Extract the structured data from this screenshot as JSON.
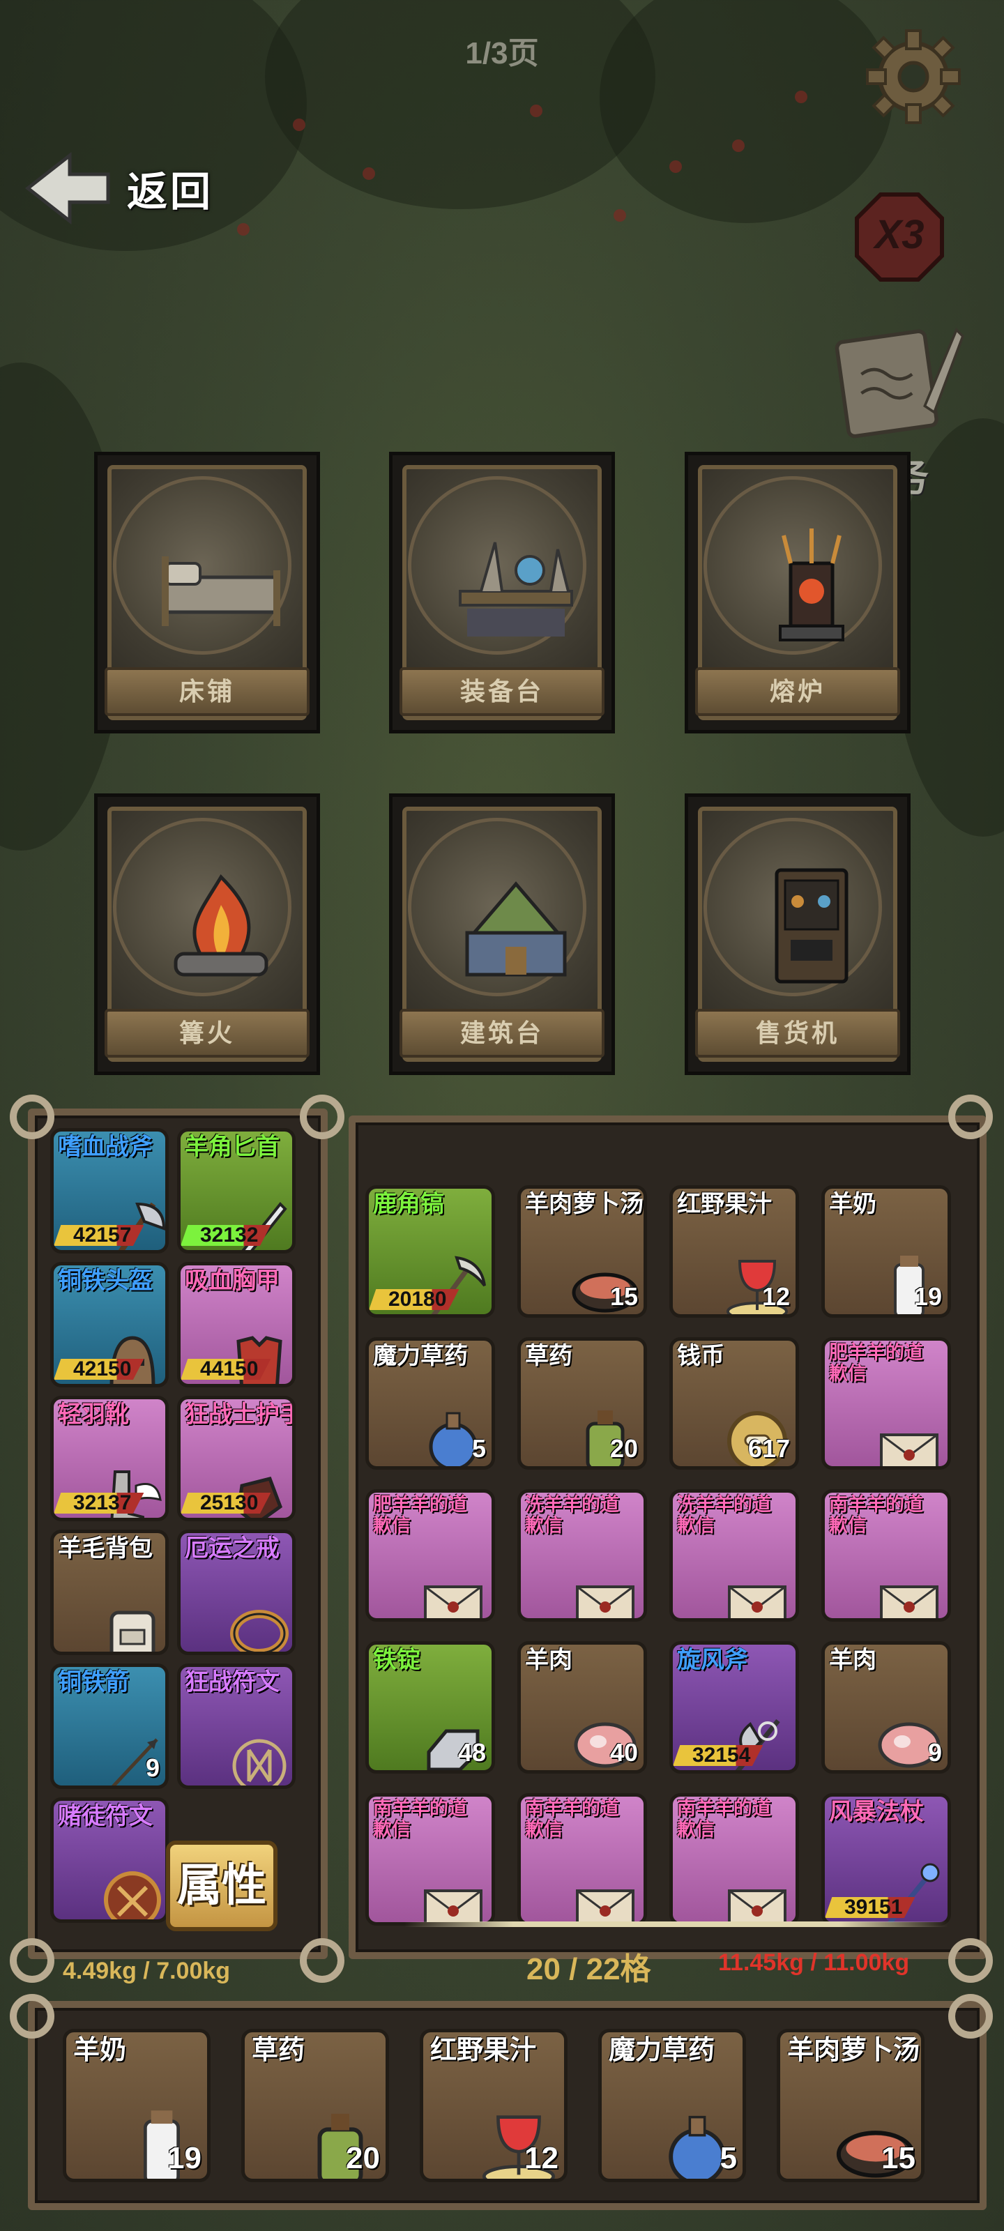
{
  "page_indicator": "1/3页",
  "back_label": "返回",
  "multiplier": "X3",
  "task_label": "任务",
  "stations": [
    {
      "label": "床铺",
      "icon": "bed-icon"
    },
    {
      "label": "装备台",
      "icon": "equipment-table-icon"
    },
    {
      "label": "熔炉",
      "icon": "furnace-icon"
    },
    {
      "label": "篝火",
      "icon": "campfire-icon"
    },
    {
      "label": "建筑台",
      "icon": "building-table-icon"
    },
    {
      "label": "售货机",
      "icon": "vending-machine-icon"
    }
  ],
  "equipment": [
    {
      "name": "嗜血战斧",
      "durability": "42157",
      "name_color": "blue",
      "bg": "blue",
      "icon": "axe-icon",
      "bar": "#e9c43c"
    },
    {
      "name": "羊角匕首",
      "durability": "32132",
      "name_color": "green",
      "bg": "green",
      "icon": "dagger-icon",
      "bar": "#7cf23d"
    },
    {
      "name": "铜铁头盔",
      "durability": "42150",
      "name_color": "blue",
      "bg": "blue",
      "icon": "helmet-icon",
      "bar": "#e9c43c"
    },
    {
      "name": "吸血胸甲",
      "durability": "44150",
      "name_color": "pink",
      "bg": "pink",
      "icon": "chestplate-icon",
      "bar": "#e9c43c"
    },
    {
      "name": "轻羽靴",
      "durability": "32137",
      "name_color": "pink",
      "bg": "pink",
      "icon": "boots-icon",
      "bar": "#e9c43c"
    },
    {
      "name": "狂战士护手",
      "durability": "25130",
      "name_color": "pink",
      "bg": "pink",
      "icon": "gauntlet-icon",
      "bar": "#e9c43c"
    },
    {
      "name": "羊毛背包",
      "count": "",
      "name_color": "white",
      "bg": "brown",
      "icon": "backpack-icon"
    },
    {
      "name": "厄运之戒",
      "count": "",
      "name_color": "purple",
      "bg": "purple",
      "icon": "ring-icon"
    },
    {
      "name": "铜铁箭",
      "count": "9",
      "name_color": "blue",
      "bg": "blue",
      "icon": "arrow-icon"
    },
    {
      "name": "狂战符文",
      "count": "",
      "name_color": "purple",
      "bg": "purple",
      "icon": "rune-icon"
    },
    {
      "name": "赌徒符文",
      "count": "",
      "name_color": "purple",
      "bg": "purple",
      "icon": "knot-rune-icon"
    }
  ],
  "attr_button": "属性",
  "equip_weight": "4.49kg / 7.00kg",
  "inventory": [
    {
      "name": "鹿角镐",
      "durability": "20180",
      "name_color": "green",
      "bg": "green",
      "icon": "pickaxe-icon",
      "bar": "#e9c43c"
    },
    {
      "name": "羊肉萝卜汤",
      "count": "15",
      "bg": "brown",
      "icon": "stew-icon"
    },
    {
      "name": "红野果汁",
      "count": "12",
      "bg": "brown",
      "icon": "juice-icon"
    },
    {
      "name": "羊奶",
      "count": "19",
      "bg": "brown",
      "icon": "milk-icon"
    },
    {
      "name": "魔力草药",
      "count": "5",
      "bg": "brown",
      "icon": "mana-potion-icon"
    },
    {
      "name": "草药",
      "count": "20",
      "bg": "brown",
      "icon": "herb-potion-icon"
    },
    {
      "name": "钱币",
      "count": "617",
      "bg": "brown",
      "icon": "coin-icon"
    },
    {
      "name": "肥羊羊的道歉信",
      "count": "",
      "name_color": "pink",
      "bg": "pink",
      "icon": "letter-icon"
    },
    {
      "name": "肥羊羊的道歉信",
      "count": "",
      "name_color": "pink",
      "bg": "pink",
      "icon": "letter-icon"
    },
    {
      "name": "洗羊羊的道歉信",
      "count": "",
      "name_color": "pink",
      "bg": "pink",
      "icon": "letter-icon"
    },
    {
      "name": "洗羊羊的道歉信",
      "count": "",
      "name_color": "pink",
      "bg": "pink",
      "icon": "letter-icon"
    },
    {
      "name": "南羊羊的道歉信",
      "count": "",
      "name_color": "pink",
      "bg": "pink",
      "icon": "letter-icon"
    },
    {
      "name": "铁锭",
      "count": "48",
      "name_color": "green",
      "bg": "green",
      "icon": "iron-ingot-icon"
    },
    {
      "name": "羊肉",
      "count": "40",
      "bg": "brown",
      "icon": "meat-icon"
    },
    {
      "name": "旋风斧",
      "durability": "32154",
      "name_color": "blue",
      "bg": "purple",
      "icon": "whirlwind-axe-icon",
      "bar": "#e9c43c"
    },
    {
      "name": "羊肉",
      "count": "9",
      "bg": "brown",
      "icon": "meat-icon"
    },
    {
      "name": "南羊羊的道歉信",
      "count": "",
      "name_color": "pink",
      "bg": "pink",
      "icon": "letter-icon"
    },
    {
      "name": "南羊羊的道歉信",
      "count": "",
      "name_color": "pink",
      "bg": "pink",
      "icon": "letter-icon"
    },
    {
      "name": "南羊羊的道歉信",
      "count": "",
      "name_color": "pink",
      "bg": "pink",
      "icon": "letter-icon"
    },
    {
      "name": "风暴法杖",
      "durability": "39151",
      "name_color": "pink",
      "bg": "purple",
      "icon": "storm-staff-icon",
      "bar": "#e9c43c"
    }
  ],
  "slot_count": "20 / 22格",
  "bag_weight": "11.45kg / 11.00kg",
  "colors": {
    "weight_ok": "#d9b75a",
    "weight_over": "#e0342a",
    "slot_count": "#d9b75a"
  },
  "hotbar": [
    {
      "name": "羊奶",
      "count": "19",
      "icon": "milk-icon"
    },
    {
      "name": "草药",
      "count": "20",
      "icon": "herb-potion-icon"
    },
    {
      "name": "红野果汁",
      "count": "12",
      "icon": "juice-icon"
    },
    {
      "name": "魔力草药",
      "count": "5",
      "icon": "mana-potion-icon"
    },
    {
      "name": "羊肉萝卜汤",
      "count": "15",
      "icon": "stew-icon"
    }
  ]
}
